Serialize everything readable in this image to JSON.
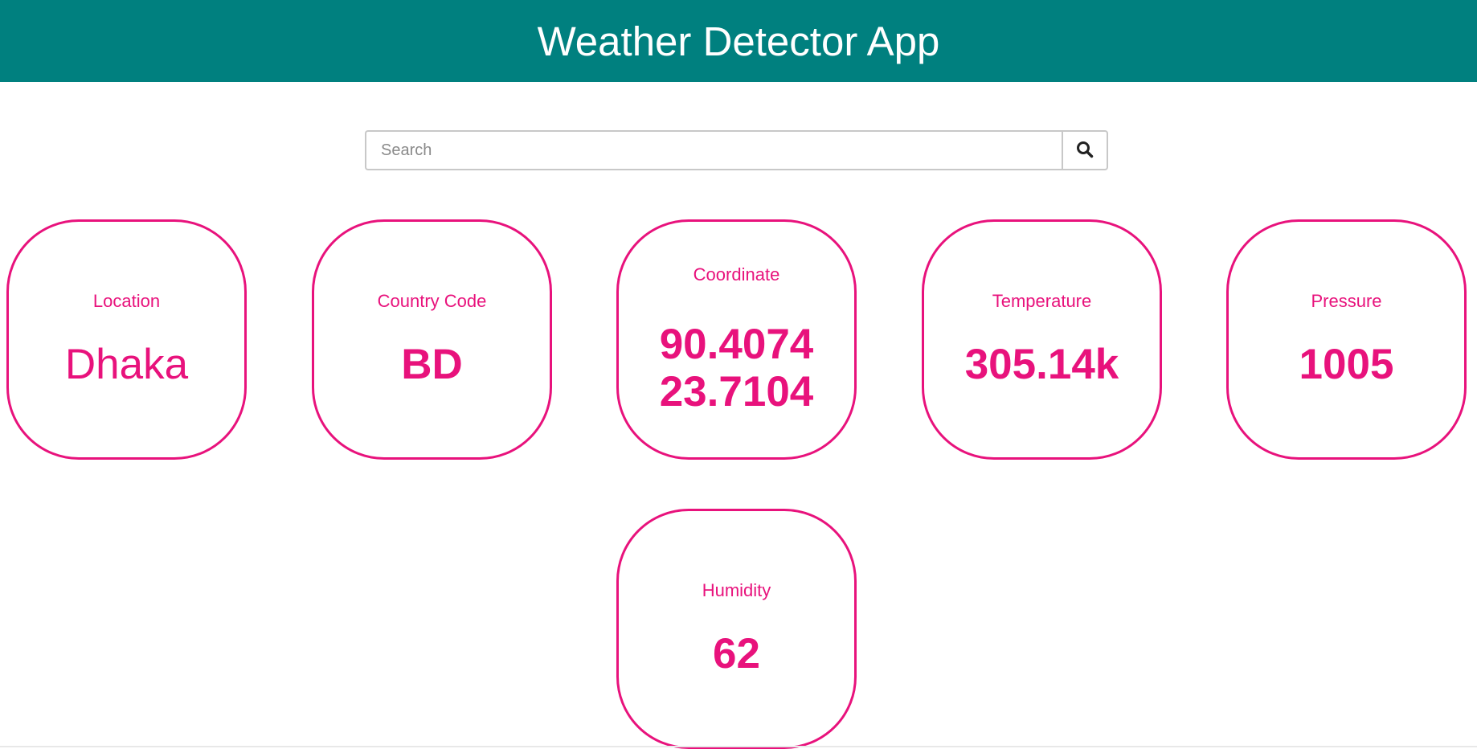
{
  "header": {
    "title": "Weather Detector App"
  },
  "search": {
    "placeholder": "Search",
    "value": ""
  },
  "cards": {
    "location": {
      "label": "Location",
      "value": "Dhaka"
    },
    "country_code": {
      "label": "Country Code",
      "value": "BD"
    },
    "coordinate": {
      "label": "Coordinate",
      "lon": "90.4074",
      "lat": "23.7104"
    },
    "temperature": {
      "label": "Temperature",
      "value": "305.14k"
    },
    "pressure": {
      "label": "Pressure",
      "value": "1005"
    },
    "humidity": {
      "label": "Humidity",
      "value": "62"
    }
  },
  "colors": {
    "header_bg": "#00807f",
    "accent": "#e8127c"
  }
}
